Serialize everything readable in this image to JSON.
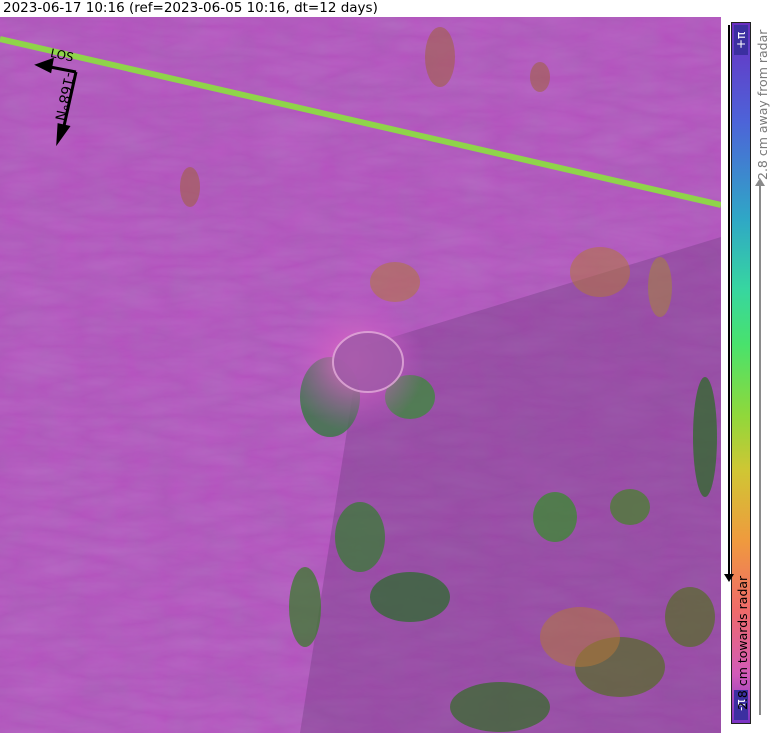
{
  "header": {
    "title": "2023-06-17 10:16 (ref=2023-06-05 10:16, dt=12 days)"
  },
  "map": {
    "los_label": "LOS",
    "heading_label": "-168°N",
    "base_color": "#c055c8",
    "track_line_color": "#8fd44a"
  },
  "colorbar": {
    "top_label": "+π",
    "bottom_label": "-π",
    "away_label": "2.8 cm away from radar",
    "towards_label": "2.8 cm towards radar"
  }
}
